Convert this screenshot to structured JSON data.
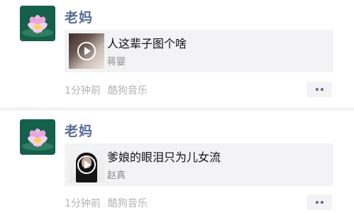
{
  "posts": [
    {
      "nickname": "老妈",
      "song_title": "人这辈子图个啥",
      "artist": "蒋婴",
      "time": "1分钟前",
      "source": "酷狗音乐"
    },
    {
      "nickname": "老妈",
      "song_title": "爹娘的眼泪只为儿女流",
      "artist": "赵真",
      "time": "1分钟前",
      "source": "酷狗音乐"
    }
  ],
  "icons": {
    "avatar": "lotus-flower-avatar",
    "play": "play-icon",
    "more": "more-dots-icon"
  },
  "colors": {
    "nickname": "#576b95",
    "meta": "#b2b2b2",
    "card_background": "#f3f3f5"
  }
}
